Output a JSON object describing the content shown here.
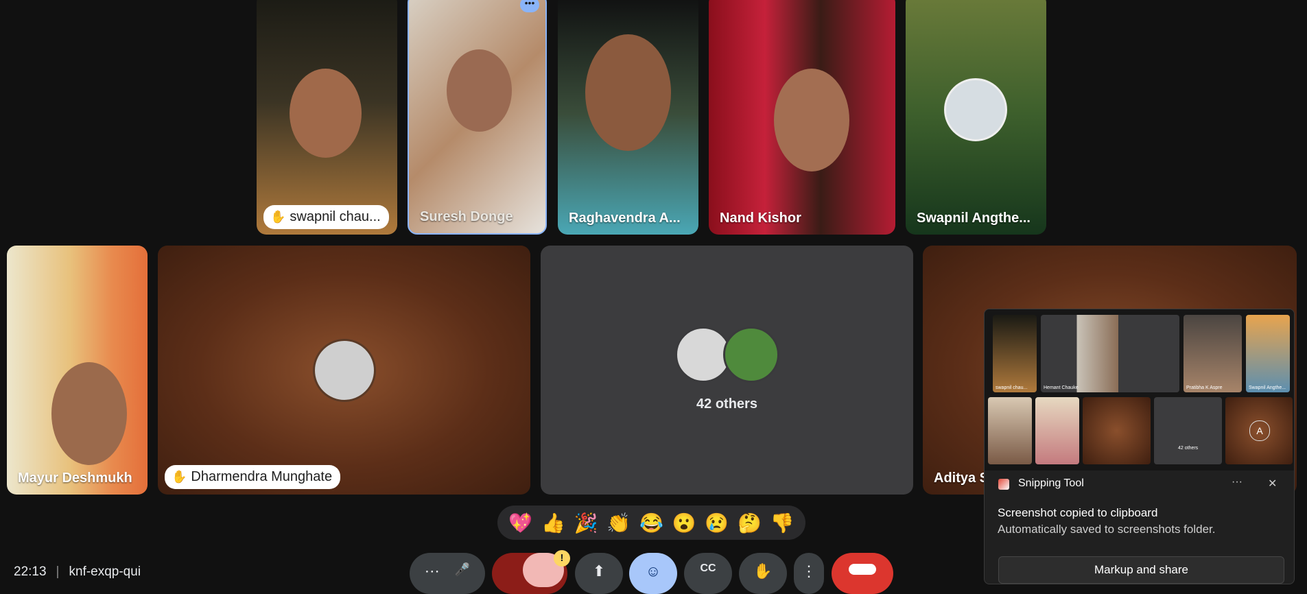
{
  "tiles": {
    "t1": {
      "name": "swapnil chau..."
    },
    "t2": {
      "name": "Suresh Donge"
    },
    "t3": {
      "name": "Raghavendra A..."
    },
    "t4": {
      "name": "Nand Kishor"
    },
    "t5": {
      "name": "Swapnil Angthe..."
    },
    "t6": {
      "name": "Mayur Deshmukh"
    },
    "t7": {
      "name": "Dharmendra Munghate"
    },
    "t8": {
      "label": "42 others"
    },
    "t9": {
      "name": "Aditya S"
    }
  },
  "reactions": [
    "💖",
    "👍",
    "🎉",
    "👏",
    "😂",
    "😮",
    "😢",
    "🤔",
    "👎"
  ],
  "bottom": {
    "time": "22:13",
    "meeting_code": "knf-exqp-qui"
  },
  "snipping": {
    "app_name": "Snipping Tool",
    "title": "Screenshot copied to clipboard",
    "subtitle": "Automatically saved to screenshots folder.",
    "button": "Markup and share",
    "more": "···",
    "close": "✕",
    "preview": {
      "n1": "swapnil chau...",
      "n2": "Hemant Chauke",
      "n3": "Pratibha K Aspre",
      "n4": "Swapnil Angthe...",
      "others": "42 others",
      "initial": "A"
    }
  },
  "controls": {
    "more": "⋯",
    "mic": "🎤",
    "camera_warning": "!",
    "present": "⬆",
    "emoji": "☺",
    "captions": "CC",
    "hand": "✋",
    "options": "⋮"
  }
}
